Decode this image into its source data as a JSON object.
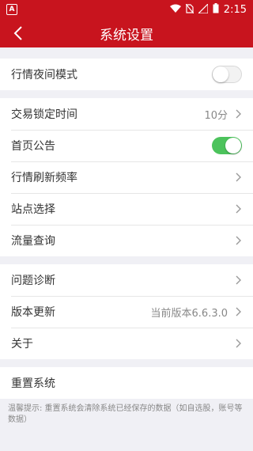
{
  "statusbar": {
    "time": "2:15",
    "app_badge": "A"
  },
  "navbar": {
    "title": "系统设置"
  },
  "groups": [
    {
      "items": [
        {
          "label": "行情夜间模式",
          "type": "toggle",
          "on": false
        }
      ]
    },
    {
      "items": [
        {
          "label": "交易锁定时间",
          "type": "value",
          "value": "10分"
        },
        {
          "label": "首页公告",
          "type": "toggle",
          "on": true
        },
        {
          "label": "行情刷新频率",
          "type": "link"
        },
        {
          "label": "站点选择",
          "type": "link"
        },
        {
          "label": "流量查询",
          "type": "link"
        }
      ]
    },
    {
      "items": [
        {
          "label": "问题诊断",
          "type": "link"
        },
        {
          "label": "版本更新",
          "type": "value",
          "value": "当前版本6.6.3.0"
        },
        {
          "label": "关于",
          "type": "link"
        }
      ]
    },
    {
      "items": [
        {
          "label": "重置系统",
          "type": "plain"
        }
      ]
    }
  ],
  "footnote": "温馨提示: 重置系统会清除系统已经保存的数据（如自选股，账号等数据）",
  "colors": {
    "brand": "#c8141e",
    "toggle_on": "#4cc35c"
  }
}
